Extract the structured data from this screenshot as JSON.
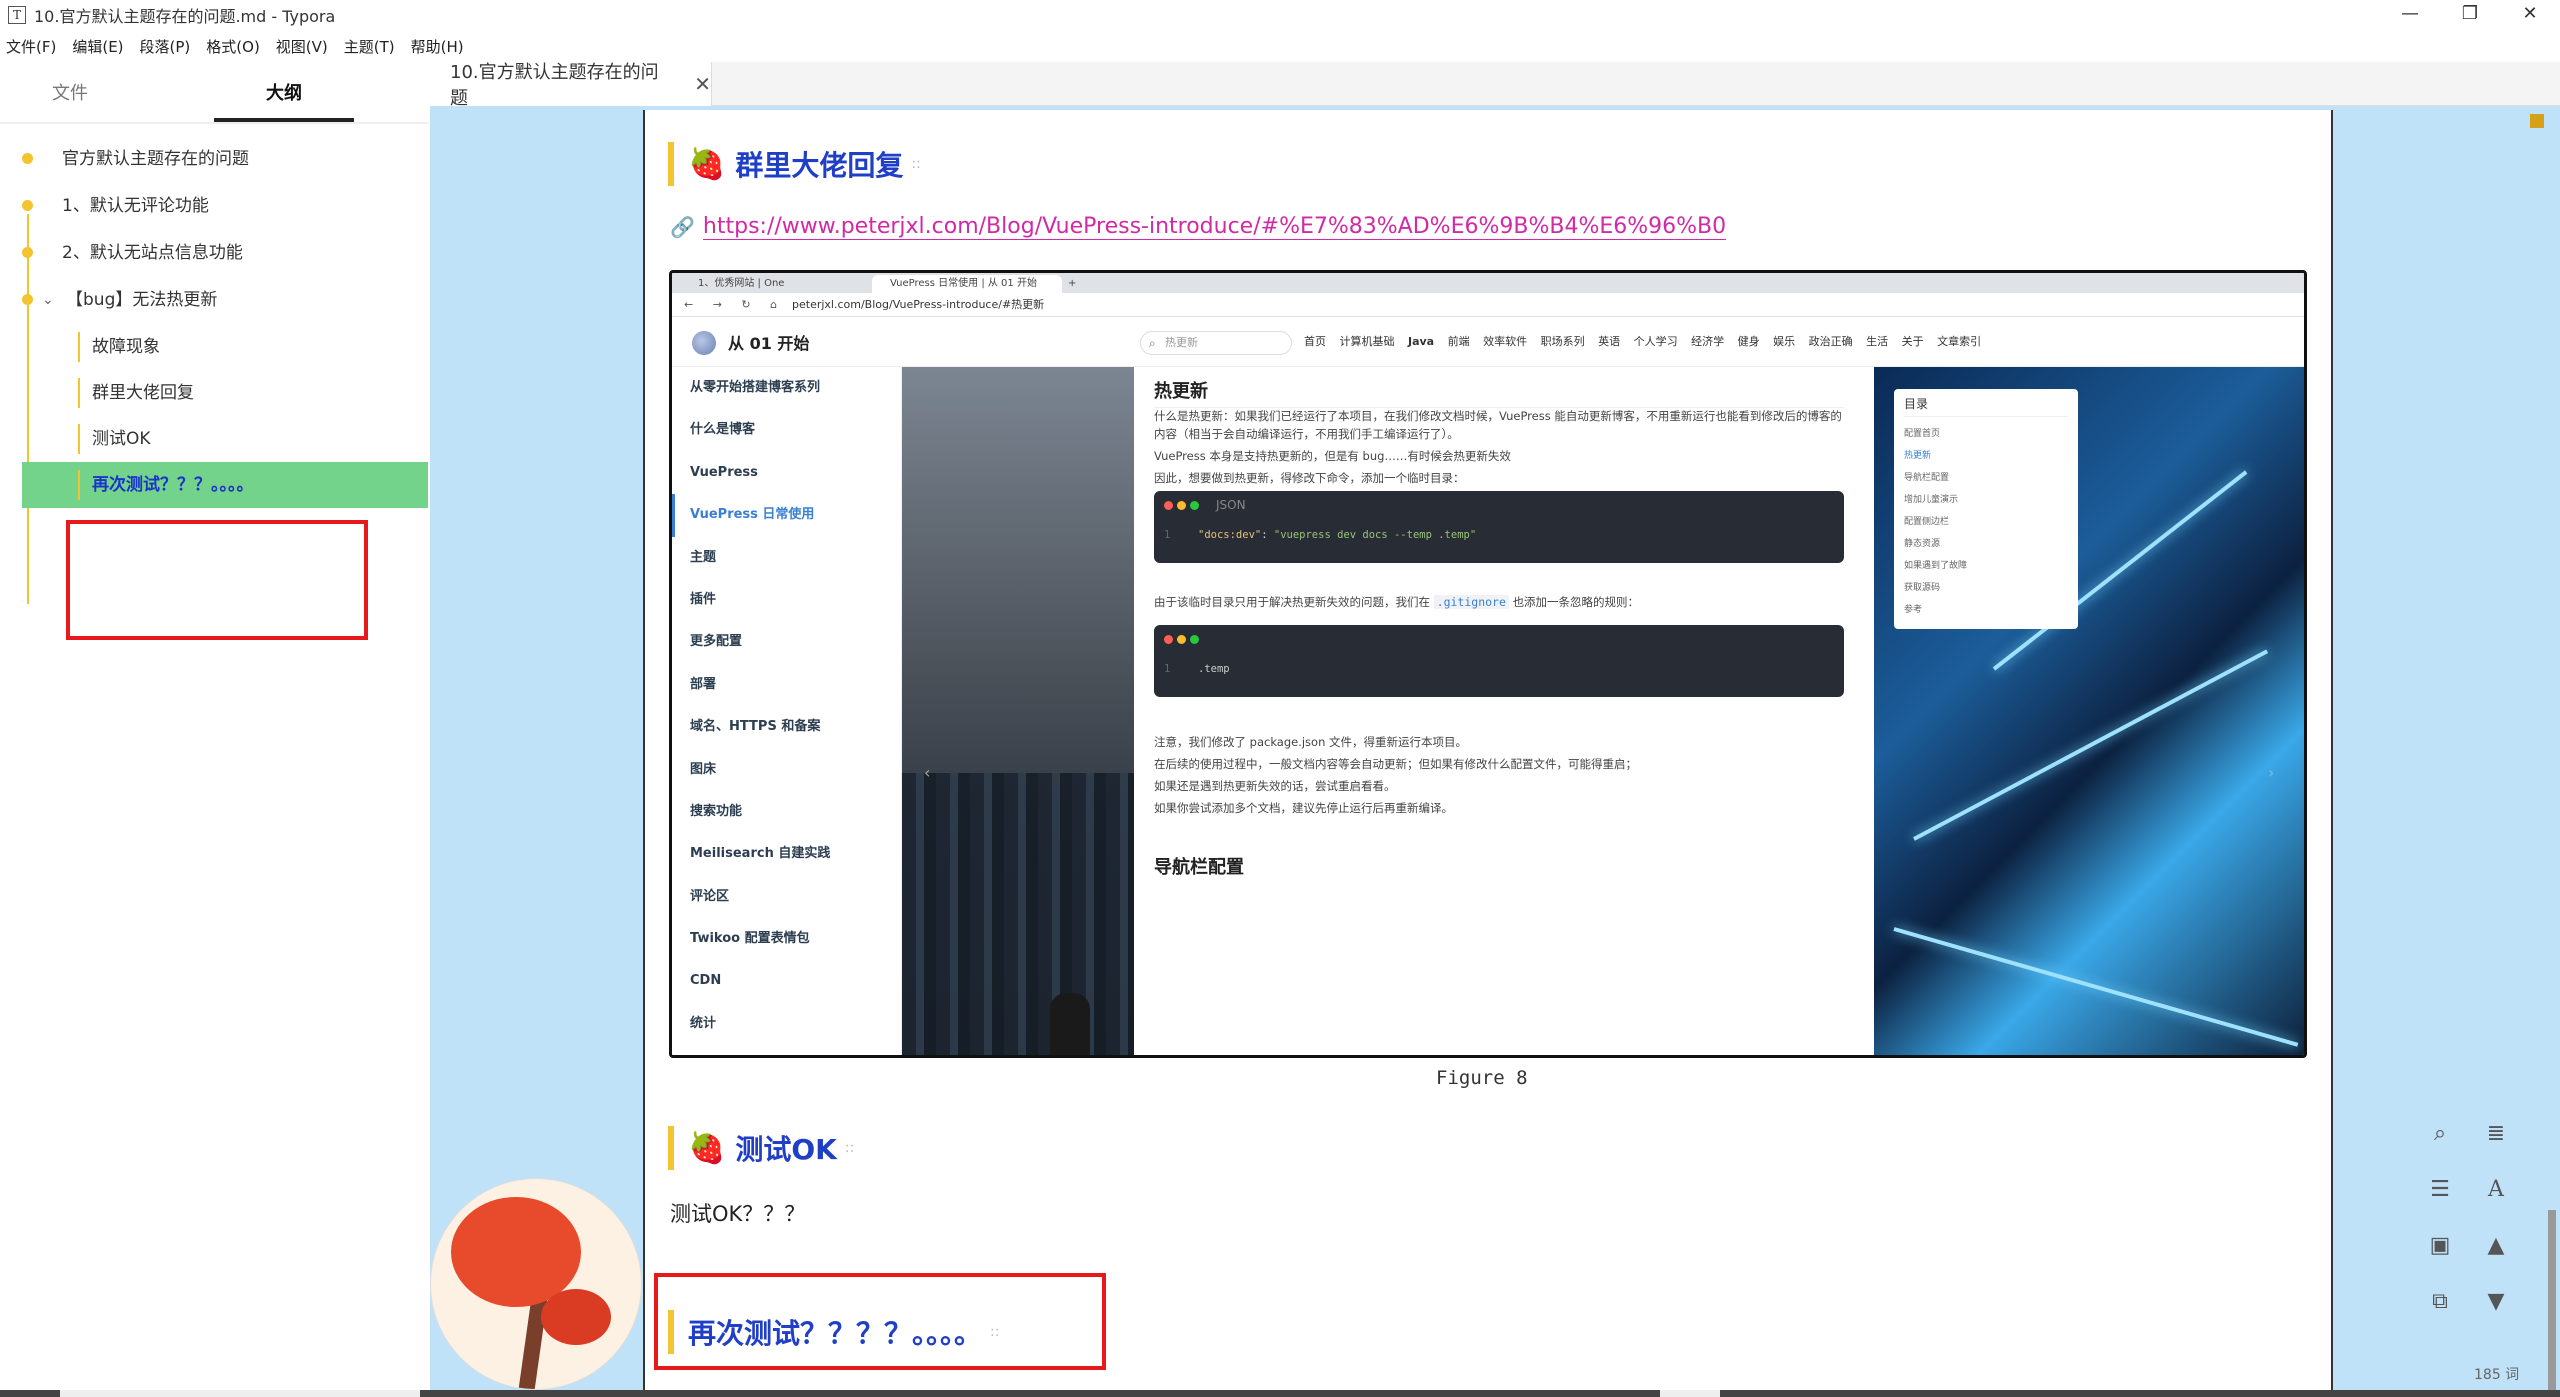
{
  "window": {
    "title": "10.官方默认主题存在的问题.md - Typora",
    "app_icon": "T",
    "controls": [
      "—",
      "❐",
      "✕"
    ]
  },
  "menu": [
    "文件(F)",
    "编辑(E)",
    "段落(P)",
    "格式(O)",
    "视图(V)",
    "主题(T)",
    "帮助(H)"
  ],
  "sidebar": {
    "tabs": [
      "文件",
      "大纲"
    ],
    "outline": [
      {
        "label": "官方默认主题存在的问题",
        "level": 1
      },
      {
        "label": "1、默认无评论功能",
        "level": 1
      },
      {
        "label": "2、默认无站点信息功能",
        "level": 1
      },
      {
        "label": "【bug】无法热更新",
        "level": 1,
        "expanded": true
      },
      {
        "label": "故障现象",
        "level": 2
      },
      {
        "label": "群里大佬回复",
        "level": 2
      },
      {
        "label": "测试OK",
        "level": 2
      },
      {
        "label": "再次测试？？？。。。。",
        "level": 2,
        "active": true
      }
    ],
    "footer_icons": [
      "<",
      "</>"
    ]
  },
  "tab": {
    "label": "10.官方默认主题存在的问题",
    "close": "✕"
  },
  "doc": {
    "heading1": "群里大佬回复",
    "link": "https://www.peterjxl.com/Blog/VuePress-introduce/#%E7%83%AD%E6%9B%B4%E6%96%B0",
    "caption": "Figure 8",
    "heading2": "测试OK",
    "paragraph": "测试OK？？？",
    "heading3": "再次测试？？？？。。。。",
    "strawberry": "🍓"
  },
  "screenshot": {
    "tabs": [
      "1、优秀网站 | One",
      "VuePress 日常使用 | 从 01 开始",
      "+"
    ],
    "address": "peterjxl.com/Blog/VuePress-introduce/#热更新",
    "site_title": "从 01 开始",
    "search_placeholder": "热更新",
    "nav": [
      "首页",
      "计算机基础",
      "Java",
      "前端",
      "效率软件",
      "职场系列",
      "英语",
      "个人学习",
      "经济学",
      "健身",
      "娱乐",
      "政治正确",
      "生活",
      "关于",
      "文章索引"
    ],
    "left_menu": [
      "从零开始搭建博客系列",
      "什么是博客",
      "VuePress",
      "VuePress 日常使用",
      "主题",
      "插件",
      "更多配置",
      "部署",
      "域名、HTTPS 和备案",
      "图床",
      "搜索功能",
      "Meilisearch 自建实践",
      "评论区",
      "Twikoo 配置表情包",
      "CDN",
      "统计"
    ],
    "article_h1": "热更新",
    "p1": "什么是热更新：如果我们已经运行了本项目，在我们修改文档时候，VuePress 能自动更新博客，不用重新运行也能看到修改后的博客的内容（相当于会自动编译运行，不用我们手工编译运行了）。",
    "p2": "VuePress 本身是支持热更新的，但是有 bug……有时候会热更新失效",
    "p3": "因此，想要做到热更新，得修改下命令，添加一个临时目录：",
    "code1_lang": "JSON",
    "code1_key": "\"docs:dev\"",
    "code1_val": "\"vuepress dev docs --temp .temp\"",
    "p4_pre": "由于该临时目录只用于解决热更新失效的问题，我们在",
    "p4_code": ".gitignore",
    "p4_post": "也添加一条忽略的规则：",
    "code2_text": ".temp",
    "p5": "注意，我们修改了 package.json 文件，得重新运行本项目。",
    "p6": "在后续的使用过程中，一般文档内容等会自动更新；但如果有修改什么配置文件，可能得重启；",
    "p7": "如果还是遇到热更新失效的话，尝试重启看看。",
    "p8": "如果你尝试添加多个文档，建议先停止运行后再重新编译。",
    "article_h2": "导航栏配置",
    "toc_title": "目录",
    "toc": [
      "配置首页",
      "热更新",
      "导航栏配置",
      "增加儿童演示",
      "配置侧边栏",
      "静态资源",
      "如果遇到了故障",
      "获取源码",
      "参考"
    ]
  },
  "word_count": "185 词",
  "tools": [
    "search-icon",
    "menu-icon",
    "list-icon",
    "font-icon",
    "image-icon",
    "up-icon",
    "tree-icon",
    "down-icon"
  ],
  "colors": {
    "accent_heading": "#1f3fc7",
    "link": "#d02aa6",
    "highlight": "#74d38a",
    "annotation": "#e8191b",
    "editor_bg": "#bfe2f8"
  }
}
